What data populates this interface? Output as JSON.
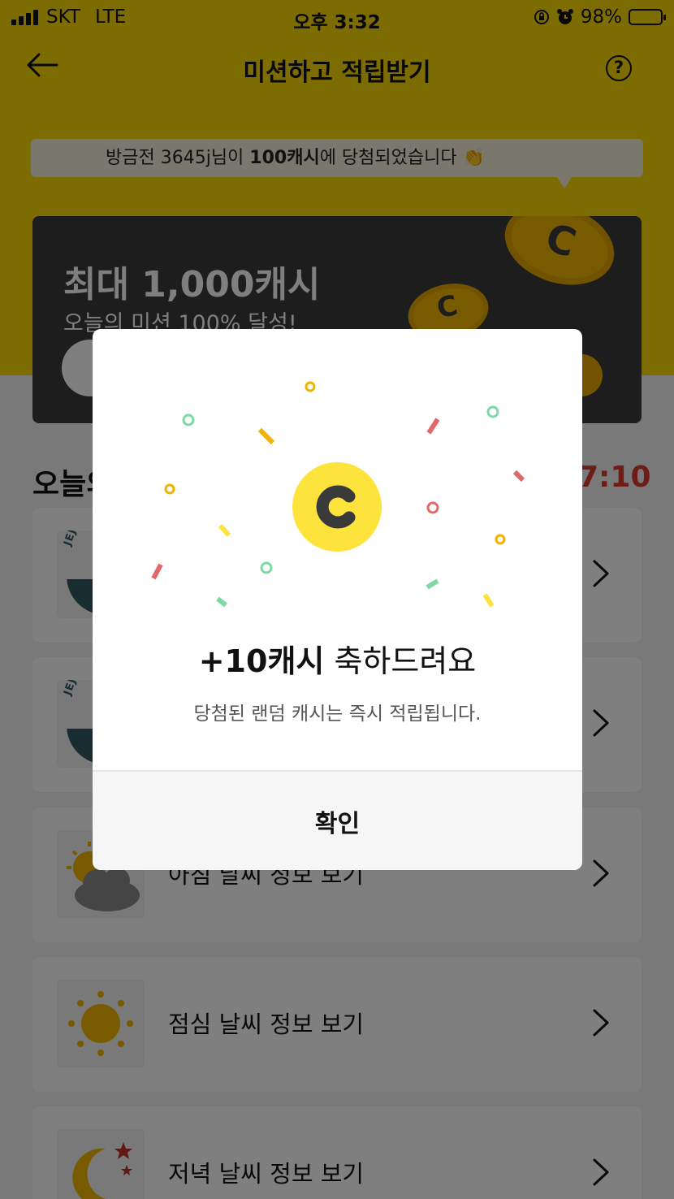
{
  "status_bar": {
    "carrier": "SKT",
    "network": "LTE",
    "time": "오후 3:32",
    "battery": "98%",
    "battery_level": 0.98
  },
  "nav": {
    "title": "미션하고 적립받기",
    "back_icon": "back-arrow-icon",
    "help_icon": "help-icon",
    "help_glyph": "?"
  },
  "ticker": {
    "prefix": "방금전 3645j님이 ",
    "highlight": "100캐시",
    "suffix": "에 당첨되었습니다 👏"
  },
  "promo": {
    "title": "최대 1,000캐시",
    "subtitle": "오늘의 미션 100% 달성!",
    "coin_glyph": "C"
  },
  "missions_section": {
    "title_visible": "오늘의",
    "timer_visible": "7:10"
  },
  "missions": [
    {
      "label": "",
      "thumb": "jeju-beer-logo",
      "thumb_text": "JEJU BEE"
    },
    {
      "label": "",
      "thumb": "jeju-beer-logo",
      "thumb_text": "JEJU BEE"
    },
    {
      "label": "아침 날씨 정보 보기",
      "thumb": "cloud-sun-icon"
    },
    {
      "label": "점심 날씨 정보 보기",
      "thumb": "sun-icon"
    },
    {
      "label": "저녁 날씨 정보 보기",
      "thumb": "moon-stars-icon"
    }
  ],
  "modal": {
    "coin_icon": "cash-coin-icon",
    "amount": "+10캐시",
    "title_suffix": " 축하드려요",
    "subtitle": "당첨된 랜덤 캐시는 즉시 적립됩니다.",
    "confirm_label": "확인"
  },
  "colors": {
    "brand_yellow": "#fbd803",
    "coin_yellow": "#fde33c",
    "timer_red": "#e0382d"
  }
}
